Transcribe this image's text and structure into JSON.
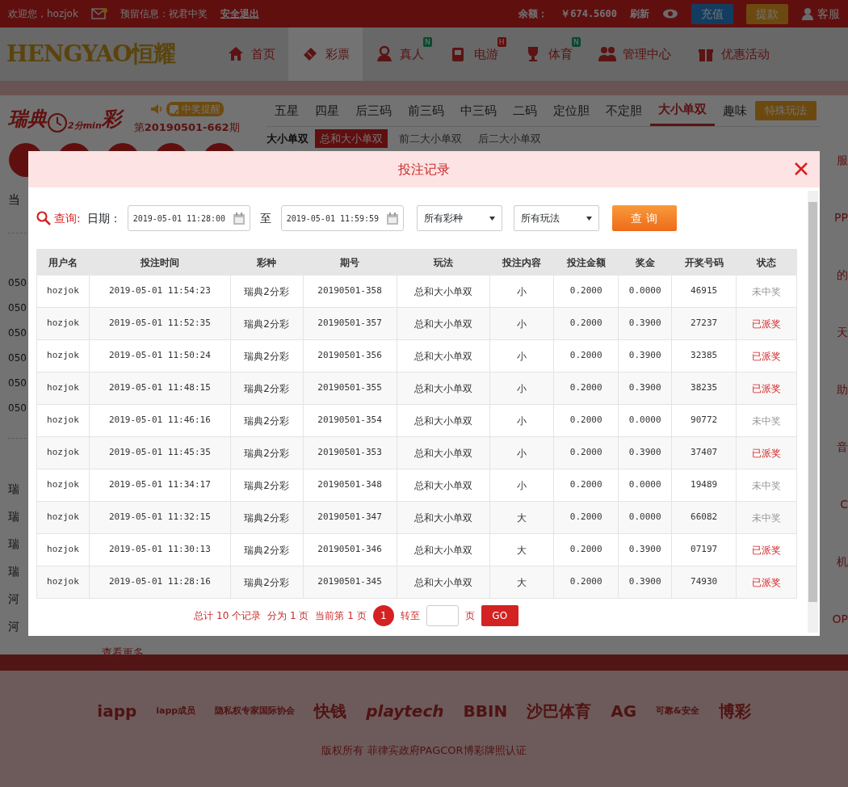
{
  "top_bar": {
    "welcome": "欢迎您，hozjok",
    "reserved_info": "预留信息：祝君中奖",
    "logout": "安全退出",
    "balance_label": "余额：",
    "balance": "￥674.5600",
    "refresh": "刷新",
    "deposit": "充值",
    "withdraw": "提款",
    "service": "客服"
  },
  "logo": {
    "latin": "HENGYAO",
    "chinese": "恒耀"
  },
  "nav": [
    {
      "label": "首页",
      "selected": false
    },
    {
      "label": "彩票",
      "selected": true
    },
    {
      "label": "真人",
      "badge": "N",
      "selected": false
    },
    {
      "label": "电游",
      "badge": "H",
      "selected": false
    },
    {
      "label": "体育",
      "badge": "N",
      "selected": false
    },
    {
      "label": "管理中心",
      "selected": false
    },
    {
      "label": "优惠活动",
      "selected": false
    }
  ],
  "lottery": {
    "logo_left": "瑞典",
    "logo_mid": "2分min",
    "logo_right": "彩",
    "alert": "中奖提醒",
    "alert_on": true,
    "issue": "第**20190501-662**期"
  },
  "play_tabs": [
    {
      "label": "五星",
      "selected": false
    },
    {
      "label": "四星",
      "selected": false
    },
    {
      "label": "后三码",
      "selected": false
    },
    {
      "label": "前三码",
      "selected": false
    },
    {
      "label": "中三码",
      "selected": false
    },
    {
      "label": "二码",
      "selected": false
    },
    {
      "label": "定位胆",
      "selected": false
    },
    {
      "label": "不定胆",
      "selected": false
    },
    {
      "label": "大小单双",
      "selected": true
    },
    {
      "label": "趣味",
      "selected": false
    }
  ],
  "special_button": "特殊玩法",
  "sub_group": "大小单双",
  "sub_tabs": [
    {
      "label": "总和大小单双",
      "selected": true
    },
    {
      "label": "前二大小单双",
      "selected": false
    },
    {
      "label": "后二大小单双",
      "selected": false
    }
  ],
  "left_partial": {
    "current": "当",
    "records": [
      "050",
      "050",
      "050",
      "050",
      "050",
      "050"
    ],
    "lotteries": [
      "瑞",
      "瑞",
      "瑞",
      "瑞",
      "河",
      "河"
    ],
    "more": "查看更多"
  },
  "right_partial": [
    "服",
    "PP",
    "的",
    "天",
    "助",
    "音",
    "C",
    "机",
    "OP"
  ],
  "modal": {
    "title": "投注记录",
    "filter": {
      "query": "查询:",
      "date_label": "日期：",
      "from": "2019-05-01 11:28:00",
      "to_label": "至",
      "to": "2019-05-01 11:59:59",
      "lottery": "所有彩种",
      "play": "所有玩法",
      "button": "查 询"
    },
    "table": {
      "columns": [
        "用户名",
        "投注时间",
        "彩种",
        "期号",
        "玩法",
        "投注内容",
        "投注金额",
        "奖金",
        "开奖号码",
        "状态"
      ],
      "rows": [
        {
          "cells": [
            "hozjok",
            "2019-05-01 11:54:23",
            "瑞典2分彩",
            "20190501-358",
            "总和大小单双",
            "小",
            "0.2000",
            "0.0000",
            "46915"
          ],
          "status": "未中奖",
          "kind": "lost"
        },
        {
          "cells": [
            "hozjok",
            "2019-05-01 11:52:35",
            "瑞典2分彩",
            "20190501-357",
            "总和大小单双",
            "小",
            "0.2000",
            "0.3900",
            "27237"
          ],
          "status": "已派奖",
          "kind": "won"
        },
        {
          "cells": [
            "hozjok",
            "2019-05-01 11:50:24",
            "瑞典2分彩",
            "20190501-356",
            "总和大小单双",
            "小",
            "0.2000",
            "0.3900",
            "32385"
          ],
          "status": "已派奖",
          "kind": "won"
        },
        {
          "cells": [
            "hozjok",
            "2019-05-01 11:48:15",
            "瑞典2分彩",
            "20190501-355",
            "总和大小单双",
            "小",
            "0.2000",
            "0.3900",
            "38235"
          ],
          "status": "已派奖",
          "kind": "won"
        },
        {
          "cells": [
            "hozjok",
            "2019-05-01 11:46:16",
            "瑞典2分彩",
            "20190501-354",
            "总和大小单双",
            "小",
            "0.2000",
            "0.0000",
            "90772"
          ],
          "status": "未中奖",
          "kind": "lost"
        },
        {
          "cells": [
            "hozjok",
            "2019-05-01 11:45:35",
            "瑞典2分彩",
            "20190501-353",
            "总和大小单双",
            "小",
            "0.2000",
            "0.3900",
            "37407"
          ],
          "status": "已派奖",
          "kind": "won"
        },
        {
          "cells": [
            "hozjok",
            "2019-05-01 11:34:17",
            "瑞典2分彩",
            "20190501-348",
            "总和大小单双",
            "小",
            "0.2000",
            "0.0000",
            "19489"
          ],
          "status": "未中奖",
          "kind": "lost"
        },
        {
          "cells": [
            "hozjok",
            "2019-05-01 11:32:15",
            "瑞典2分彩",
            "20190501-347",
            "总和大小单双",
            "大",
            "0.2000",
            "0.0000",
            "66082"
          ],
          "status": "未中奖",
          "kind": "lost"
        },
        {
          "cells": [
            "hozjok",
            "2019-05-01 11:30:13",
            "瑞典2分彩",
            "20190501-346",
            "总和大小单双",
            "大",
            "0.2000",
            "0.3900",
            "07197"
          ],
          "status": "已派奖",
          "kind": "won"
        },
        {
          "cells": [
            "hozjok",
            "2019-05-01 11:28:16",
            "瑞典2分彩",
            "20190501-345",
            "总和大小单双",
            "大",
            "0.2000",
            "0.3900",
            "74930"
          ],
          "status": "已派奖",
          "kind": "won"
        }
      ]
    },
    "pagination": {
      "total": "总计 10 个记录",
      "pages": "分为 1 页",
      "current": "当前第 1 页",
      "page_buttons": [
        {
          "label": "1",
          "selected": true
        }
      ],
      "goto": "转至",
      "page_unit": "页",
      "go": "GO"
    }
  },
  "footer": {
    "partners": [
      "iapp",
      "iapp成员",
      "隐私权专家国际协会",
      "快钱",
      "playtech",
      "BBIN",
      "沙巴体育",
      "AG",
      "可靠&安全",
      "博彩"
    ],
    "copyright": "版权所有 菲律宾政府PAGCOR博彩牌照认证"
  }
}
